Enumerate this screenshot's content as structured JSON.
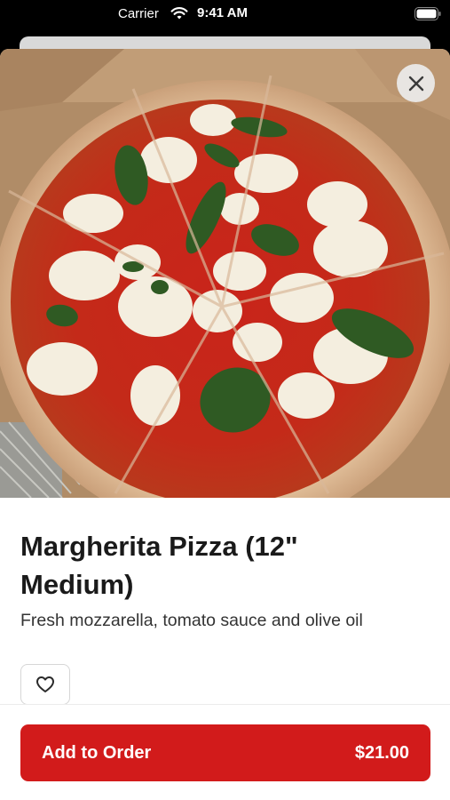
{
  "status_bar": {
    "carrier": "Carrier",
    "time": "9:41 AM"
  },
  "item": {
    "title": "Margherita Pizza (12\" Medium)",
    "description": "Fresh mozzarella, tomato sauce and olive oil"
  },
  "actions": {
    "add_to_order_label": "Add to Order",
    "price": "$21.00"
  },
  "icons": {
    "close": "close-icon",
    "favorite": "heart-icon",
    "wifi": "wifi-icon",
    "battery": "battery-icon"
  },
  "colors": {
    "accent": "#d21b1b"
  }
}
